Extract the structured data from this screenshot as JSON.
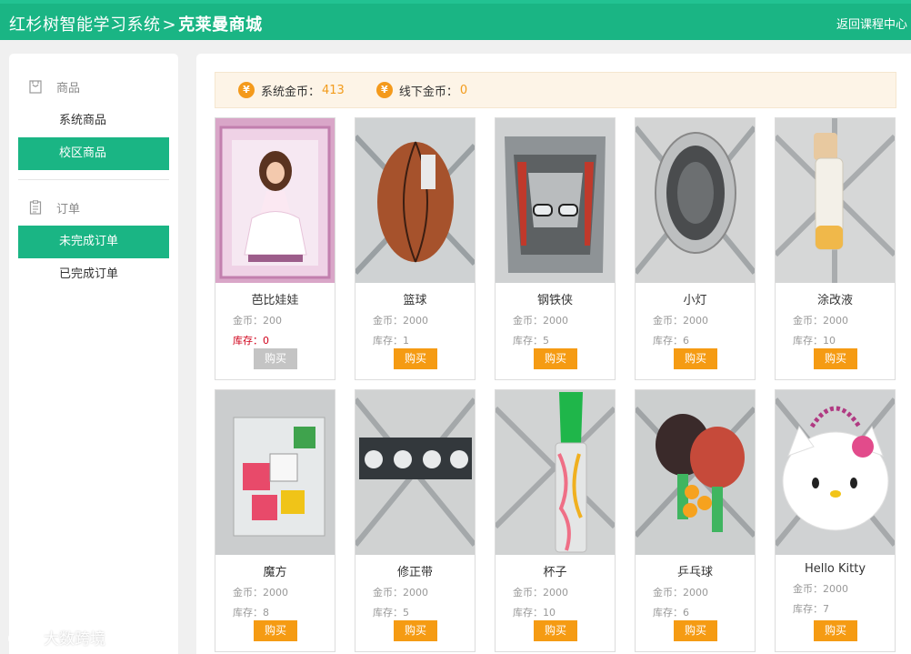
{
  "header": {
    "system_title": "红杉树智能学习系统",
    "separator": ">",
    "shop_title": "克莱曼商城",
    "back_link": "返回课程中心"
  },
  "sidebar": {
    "goods_heading": "商品",
    "goods_items": [
      "系统商品",
      "校区商品"
    ],
    "orders_heading": "订单",
    "order_items": [
      "未完成订单",
      "已完成订单"
    ]
  },
  "coins": {
    "system_label": "系统金币：",
    "system_value": "413",
    "offline_label": "线下金币：",
    "offline_value": "0",
    "icon_glyph": "¥"
  },
  "labels": {
    "coin_label": "金币：",
    "stock_label": "库存：",
    "buy": "购买"
  },
  "products": [
    {
      "name": "芭比娃娃",
      "coins": "200",
      "stock": "0"
    },
    {
      "name": "篮球",
      "coins": "2000",
      "stock": "1"
    },
    {
      "name": "钢铁侠",
      "coins": "2000",
      "stock": "5"
    },
    {
      "name": "小灯",
      "coins": "2000",
      "stock": "6"
    },
    {
      "name": "涂改液",
      "coins": "2000",
      "stock": "10"
    },
    {
      "name": "魔方",
      "coins": "2000",
      "stock": "8"
    },
    {
      "name": "修正带",
      "coins": "2000",
      "stock": "5"
    },
    {
      "name": "杯子",
      "coins": "2000",
      "stock": "10"
    },
    {
      "name": "乒乓球",
      "coins": "2000",
      "stock": "6"
    },
    {
      "name": "Hello Kitty",
      "coins": "2000",
      "stock": "7"
    }
  ],
  "watermark": "大数跨境",
  "colors": {
    "brand_green": "#1ab584",
    "buy_orange": "#f59b13",
    "coin_orange": "#f29b1b",
    "disabled_gray": "#c4c4c4",
    "out_of_stock_red": "#d0021b"
  }
}
